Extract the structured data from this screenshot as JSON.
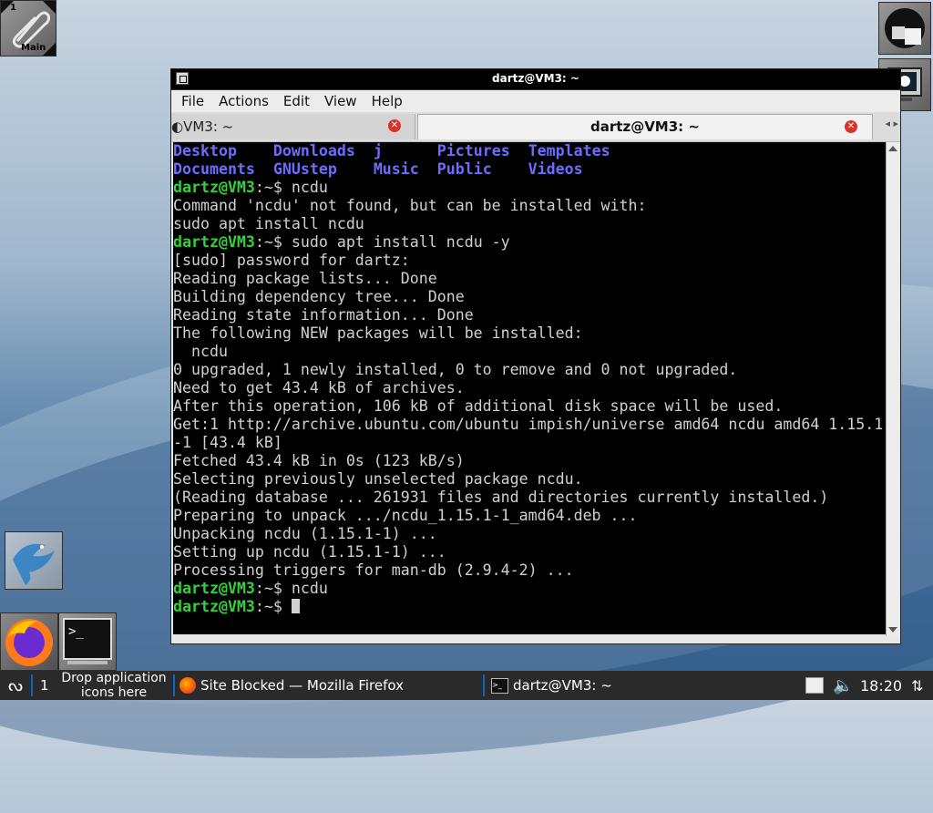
{
  "desktop": {
    "workspace_clip": {
      "number": "1",
      "label": "Main"
    }
  },
  "window": {
    "title": "dartz@VM3: ~",
    "menu": [
      "File",
      "Actions",
      "Edit",
      "View",
      "Help"
    ],
    "tabs": [
      {
        "label": "◐VM3: ~",
        "active": false
      },
      {
        "label": "dartz@VM3: ~",
        "active": true
      }
    ]
  },
  "terminal": {
    "ls_row1": [
      "Desktop",
      "Downloads",
      "j",
      "Pictures",
      "Templates"
    ],
    "ls_row2": [
      "Documents",
      "GNUstep",
      "Music",
      "Public",
      "Videos"
    ],
    "prompt_user": "dartz@VM3",
    "prompt_path": ":~$",
    "cmd1": " ncdu",
    "out1": "Command 'ncdu' not found, but can be installed with:",
    "out2": "sudo apt install ncdu",
    "cmd2": " sudo apt install ncdu -y",
    "output_lines": [
      "[sudo] password for dartz:",
      "Reading package lists... Done",
      "Building dependency tree... Done",
      "Reading state information... Done",
      "The following NEW packages will be installed:",
      "  ncdu",
      "0 upgraded, 1 newly installed, 0 to remove and 0 not upgraded.",
      "Need to get 43.4 kB of archives.",
      "After this operation, 106 kB of additional disk space will be used.",
      "Get:1 http://archive.ubuntu.com/ubuntu impish/universe amd64 ncdu amd64 1.15.1",
      "-1 [43.4 kB]",
      "Fetched 43.4 kB in 0s (123 kB/s)",
      "Selecting previously unselected package ncdu.",
      "(Reading database ... 261931 files and directories currently installed.)",
      "Preparing to unpack .../ncdu_1.15.1-1_amd64.deb ...",
      "Unpacking ncdu (1.15.1-1) ...",
      "Setting up ncdu (1.15.1-1) ...",
      "Processing triggers for man-db (2.9.4-2) ..."
    ],
    "cmd3": " ncdu",
    "cmd4": " "
  },
  "taskbar": {
    "workspace": "1",
    "drop_text_1": "Drop application",
    "drop_text_2": "icons here",
    "apps": [
      {
        "label": "Site Blocked — Mozilla Firefox",
        "icon": "firefox-icon"
      },
      {
        "label": "dartz@VM3: ~",
        "icon": "terminal-icon"
      }
    ],
    "clock": "18:20"
  },
  "colors": {
    "ls_dir": "#6e6cff",
    "prompt": "#36d13a",
    "terminal_bg": "#000000",
    "terminal_fg": "#d0d0d0"
  }
}
